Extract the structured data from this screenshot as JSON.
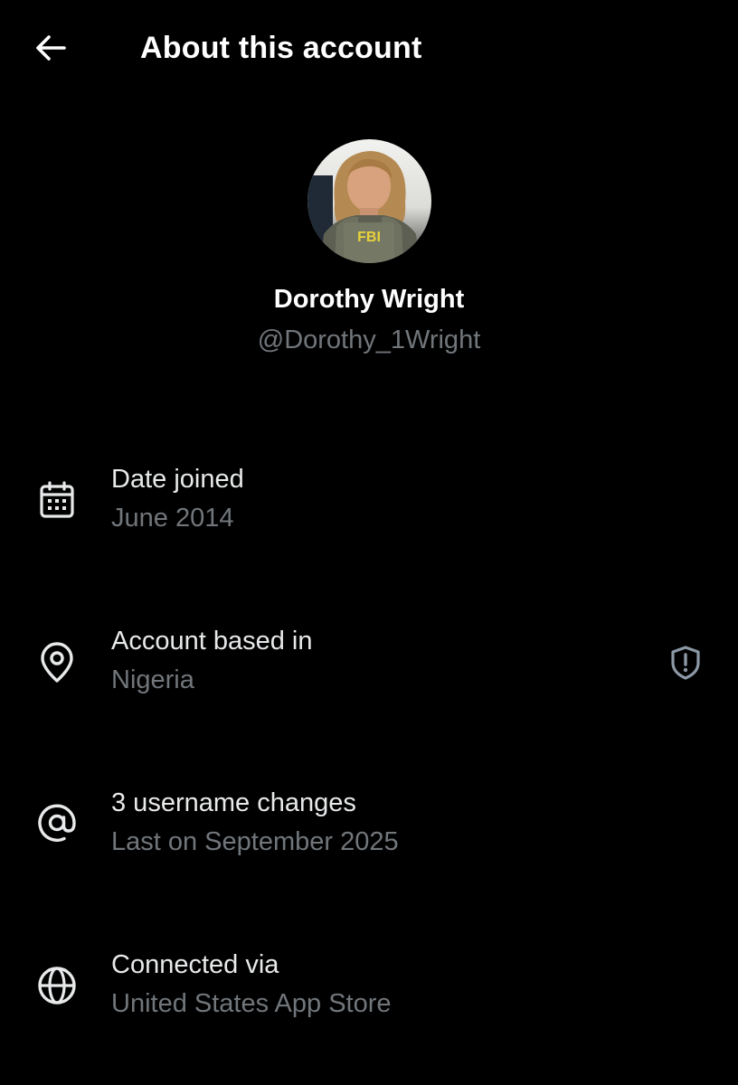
{
  "header": {
    "back_icon": "arrow-left-icon",
    "title": "About this account"
  },
  "profile": {
    "display_name": "Dorothy Wright",
    "handle": "@Dorothy_1Wright",
    "avatar_badge_text": "FBI"
  },
  "rows": [
    {
      "icon": "calendar-icon",
      "title": "Date joined",
      "value": "June 2014"
    },
    {
      "icon": "location-pin-icon",
      "title": "Account based in",
      "value": "Nigeria",
      "trailing_icon": "shield-alert-icon"
    },
    {
      "icon": "at-sign-icon",
      "title": "3 username changes",
      "value": "Last on September 2025"
    },
    {
      "icon": "globe-icon",
      "title": "Connected via",
      "value": "United States App Store"
    }
  ],
  "colors": {
    "background": "#000000",
    "primary_text": "#e7e9ea",
    "secondary_text": "#71767b",
    "icon": "#e7e9ea",
    "trailing_icon": "#8b98a5"
  }
}
